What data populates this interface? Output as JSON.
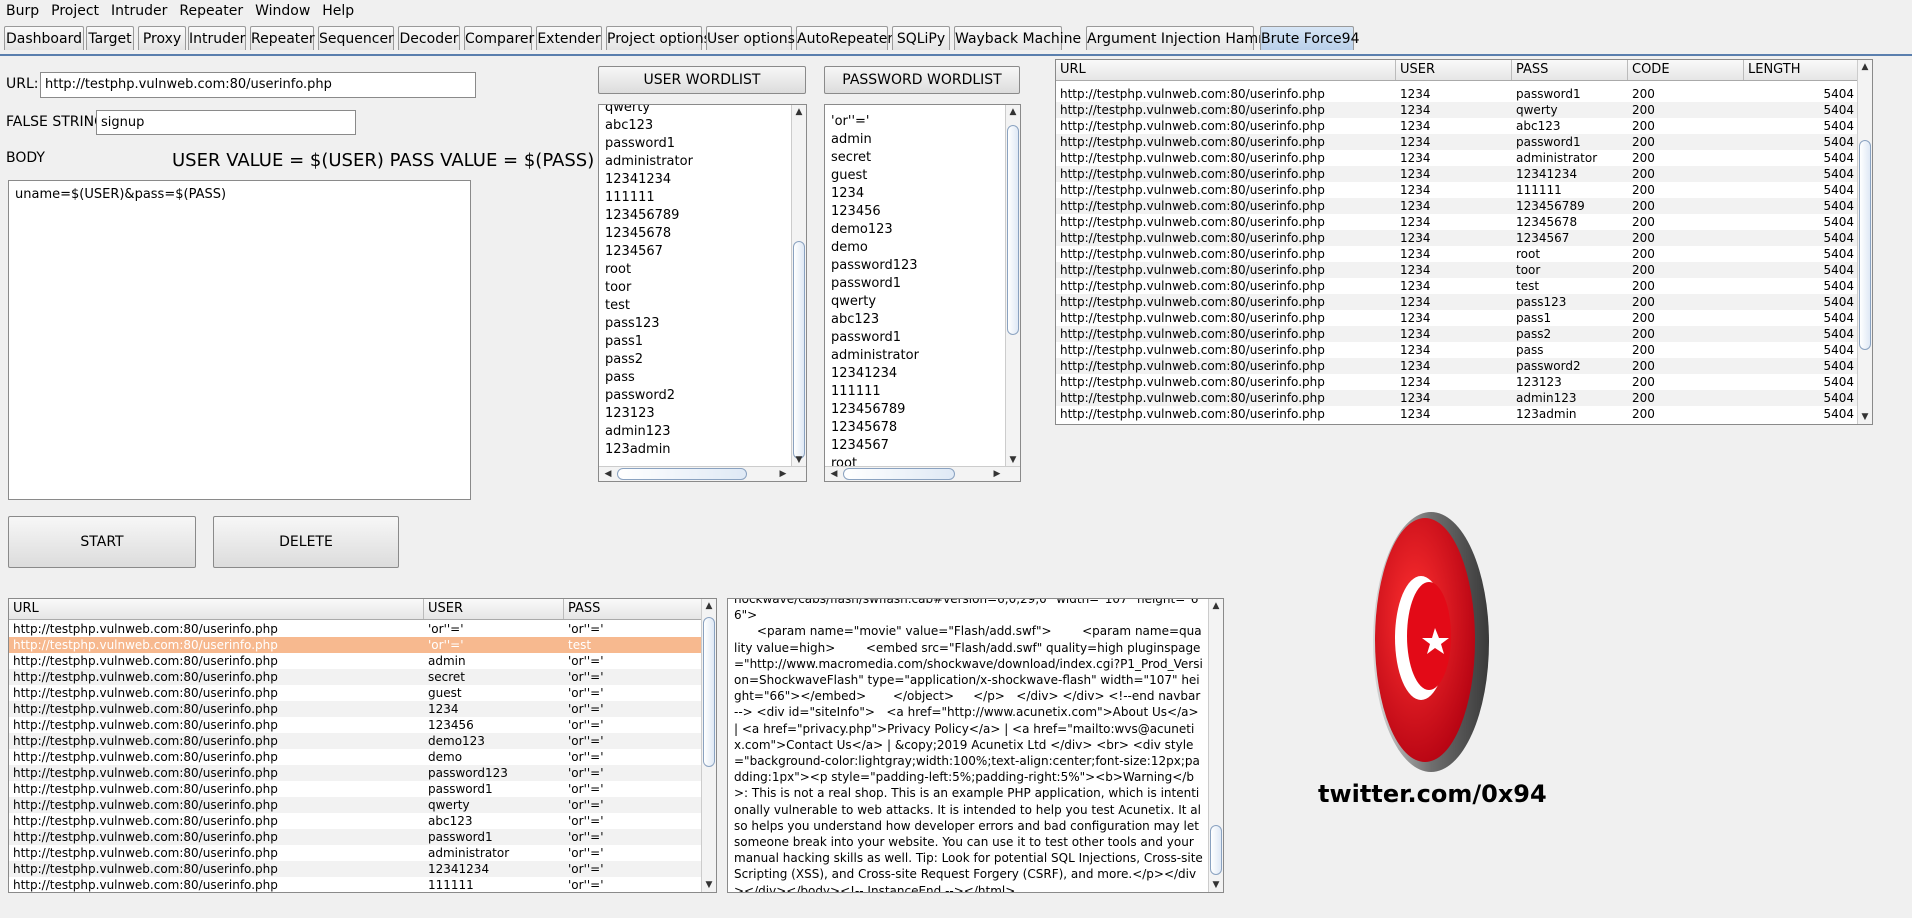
{
  "menu": [
    "Burp",
    "Project",
    "Intruder",
    "Repeater",
    "Window",
    "Help"
  ],
  "tabs": [
    "Dashboard",
    "Target",
    "Proxy",
    "Intruder",
    "Repeater",
    "Sequencer",
    "Decoder",
    "Comparer",
    "Extender",
    "Project options",
    "User options",
    "AutoRepeater",
    "SQLiPy",
    "Wayback Machine",
    "Argument Injection Hammer",
    "Brute Force94"
  ],
  "active_tab": "Brute Force94",
  "form": {
    "url_label": "URL:",
    "url_value": "http://testphp.vulnweb.com:80/userinfo.php",
    "false_label": "FALSE STRING:",
    "false_value": "signup",
    "body_label": "BODY",
    "hint": "USER VALUE = $(USER) PASS VALUE =  $(PASS)",
    "body_value": "uname=$(USER)&pass=$(PASS)"
  },
  "buttons": {
    "user_wordlist": "USER WORDLIST",
    "password_wordlist": "PASSWORD WORDLIST",
    "start": "START",
    "delete": "DELETE"
  },
  "user_wordlist": [
    "qwerty",
    "abc123",
    "password1",
    "administrator",
    "12341234",
    "111111",
    "123456789",
    "12345678",
    "1234567",
    "root",
    "toor",
    "test",
    "pass123",
    "pass1",
    "pass2",
    "pass",
    "password2",
    "123123",
    "admin123",
    "123admin"
  ],
  "password_wordlist": [
    "'or''='",
    "admin",
    "secret",
    "guest",
    "1234",
    "123456",
    "demo123",
    "demo",
    "password123",
    "password1",
    "qwerty",
    "abc123",
    "password1",
    "administrator",
    "12341234",
    "111111",
    "123456789",
    "12345678",
    "1234567",
    "root"
  ],
  "results_table": {
    "columns": [
      "URL",
      "USER",
      "PASS",
      "CODE",
      "LENGTH"
    ],
    "rows": [
      [
        "http://testphp.vulnweb.com:80/userinfo.php",
        "1234",
        "password1",
        "200",
        "5404"
      ],
      [
        "http://testphp.vulnweb.com:80/userinfo.php",
        "1234",
        "qwerty",
        "200",
        "5404"
      ],
      [
        "http://testphp.vulnweb.com:80/userinfo.php",
        "1234",
        "abc123",
        "200",
        "5404"
      ],
      [
        "http://testphp.vulnweb.com:80/userinfo.php",
        "1234",
        "password1",
        "200",
        "5404"
      ],
      [
        "http://testphp.vulnweb.com:80/userinfo.php",
        "1234",
        "administrator",
        "200",
        "5404"
      ],
      [
        "http://testphp.vulnweb.com:80/userinfo.php",
        "1234",
        "12341234",
        "200",
        "5404"
      ],
      [
        "http://testphp.vulnweb.com:80/userinfo.php",
        "1234",
        "111111",
        "200",
        "5404"
      ],
      [
        "http://testphp.vulnweb.com:80/userinfo.php",
        "1234",
        "123456789",
        "200",
        "5404"
      ],
      [
        "http://testphp.vulnweb.com:80/userinfo.php",
        "1234",
        "12345678",
        "200",
        "5404"
      ],
      [
        "http://testphp.vulnweb.com:80/userinfo.php",
        "1234",
        "1234567",
        "200",
        "5404"
      ],
      [
        "http://testphp.vulnweb.com:80/userinfo.php",
        "1234",
        "root",
        "200",
        "5404"
      ],
      [
        "http://testphp.vulnweb.com:80/userinfo.php",
        "1234",
        "toor",
        "200",
        "5404"
      ],
      [
        "http://testphp.vulnweb.com:80/userinfo.php",
        "1234",
        "test",
        "200",
        "5404"
      ],
      [
        "http://testphp.vulnweb.com:80/userinfo.php",
        "1234",
        "pass123",
        "200",
        "5404"
      ],
      [
        "http://testphp.vulnweb.com:80/userinfo.php",
        "1234",
        "pass1",
        "200",
        "5404"
      ],
      [
        "http://testphp.vulnweb.com:80/userinfo.php",
        "1234",
        "pass2",
        "200",
        "5404"
      ],
      [
        "http://testphp.vulnweb.com:80/userinfo.php",
        "1234",
        "pass",
        "200",
        "5404"
      ],
      [
        "http://testphp.vulnweb.com:80/userinfo.php",
        "1234",
        "password2",
        "200",
        "5404"
      ],
      [
        "http://testphp.vulnweb.com:80/userinfo.php",
        "1234",
        "123123",
        "200",
        "5404"
      ],
      [
        "http://testphp.vulnweb.com:80/userinfo.php",
        "1234",
        "admin123",
        "200",
        "5404"
      ],
      [
        "http://testphp.vulnweb.com:80/userinfo.php",
        "1234",
        "123admin",
        "200",
        "5404"
      ]
    ]
  },
  "found_table": {
    "columns": [
      "URL",
      "USER",
      "PASS"
    ],
    "selected_row": 1,
    "rows": [
      [
        "http://testphp.vulnweb.com:80/userinfo.php",
        "'or''='",
        "'or''='"
      ],
      [
        "http://testphp.vulnweb.com:80/userinfo.php",
        "'or''='",
        "test"
      ],
      [
        "http://testphp.vulnweb.com:80/userinfo.php",
        "admin",
        "'or''='"
      ],
      [
        "http://testphp.vulnweb.com:80/userinfo.php",
        "secret",
        "'or''='"
      ],
      [
        "http://testphp.vulnweb.com:80/userinfo.php",
        "guest",
        "'or''='"
      ],
      [
        "http://testphp.vulnweb.com:80/userinfo.php",
        "1234",
        "'or''='"
      ],
      [
        "http://testphp.vulnweb.com:80/userinfo.php",
        "123456",
        "'or''='"
      ],
      [
        "http://testphp.vulnweb.com:80/userinfo.php",
        "demo123",
        "'or''='"
      ],
      [
        "http://testphp.vulnweb.com:80/userinfo.php",
        "demo",
        "'or''='"
      ],
      [
        "http://testphp.vulnweb.com:80/userinfo.php",
        "password123",
        "'or''='"
      ],
      [
        "http://testphp.vulnweb.com:80/userinfo.php",
        "password1",
        "'or''='"
      ],
      [
        "http://testphp.vulnweb.com:80/userinfo.php",
        "qwerty",
        "'or''='"
      ],
      [
        "http://testphp.vulnweb.com:80/userinfo.php",
        "abc123",
        "'or''='"
      ],
      [
        "http://testphp.vulnweb.com:80/userinfo.php",
        "password1",
        "'or''='"
      ],
      [
        "http://testphp.vulnweb.com:80/userinfo.php",
        "administrator",
        "'or''='"
      ],
      [
        "http://testphp.vulnweb.com:80/userinfo.php",
        "12341234",
        "'or''='"
      ],
      [
        "http://testphp.vulnweb.com:80/userinfo.php",
        "111111",
        "'or''='"
      ]
    ]
  },
  "response_text": "hockwave/cabs/flash/swflash.cab#version=6,0,29,0\" width=\"107\" height=\"66\">\n      <param name=\"movie\" value=\"Flash/add.swf\">        <param name=quality value=high>        <embed src=\"Flash/add.swf\" quality=high pluginspage=\"http://www.macromedia.com/shockwave/download/index.cgi?P1_Prod_Version=ShockwaveFlash\" type=\"application/x-shockwave-flash\" width=\"107\" height=\"66\"></embed>       </object>     </p>   </div> </div> <!--end navbar --> <div id=\"siteInfo\">   <a href=\"http://www.acunetix.com\">About Us</a> | <a href=\"privacy.php\">Privacy Policy</a> | <a href=\"mailto:wvs@acunetix.com\">Contact Us</a> | &copy;2019 Acunetix Ltd </div> <br> <div style=\"background-color:lightgray;width:100%;text-align:center;font-size:12px;padding:1px\"><p style=\"padding-left:5%;padding-right:5%\"><b>Warning</b>: This is not a real shop. This is an example PHP application, which is intentionally vulnerable to web attacks. It is intended to help you test Acunetix. It also helps you understand how developer errors and bad configuration may let someone break into your website. You can use it to test other tools and your manual hacking skills as well. Tip: Look for potential SQL Injections, Cross-site Scripting (XSS), and Cross-site Request Forgery (CSRF), and more.</p></div></div></body><!-- InstanceEnd --></html>",
  "twitter": "twitter.com/0x94",
  "colors": {
    "accent": "#5a7fae",
    "selected_row": "#f7b98f",
    "flag_red": "#e30a17"
  }
}
